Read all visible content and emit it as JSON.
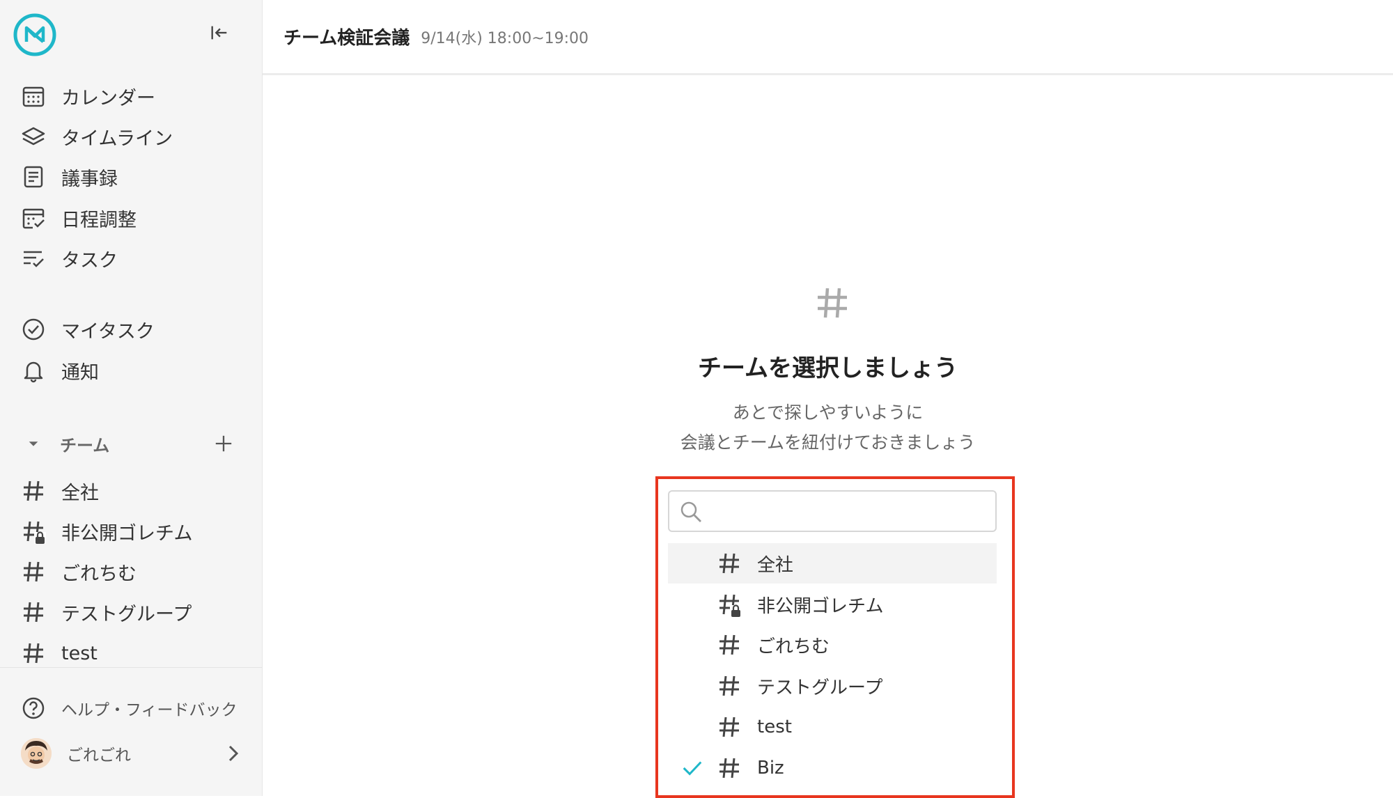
{
  "header": {
    "title": "チーム検証会議",
    "time": "9/14(水) 18:00~19:00"
  },
  "sidebar": {
    "nav": [
      {
        "label": "カレンダー",
        "icon": "calendar-icon"
      },
      {
        "label": "タイムライン",
        "icon": "layers-icon"
      },
      {
        "label": "議事録",
        "icon": "document-icon"
      },
      {
        "label": "日程調整",
        "icon": "schedule-check-icon"
      },
      {
        "label": "タスク",
        "icon": "task-list-icon"
      }
    ],
    "nav2": [
      {
        "label": "マイタスク",
        "icon": "check-circle-icon"
      },
      {
        "label": "通知",
        "icon": "bell-icon"
      }
    ],
    "team_section": "チーム",
    "teams": [
      {
        "label": "全社",
        "private": false
      },
      {
        "label": "非公開ゴレチム",
        "private": true
      },
      {
        "label": "ごれちむ",
        "private": false
      },
      {
        "label": "テストグループ",
        "private": false
      },
      {
        "label": "test",
        "private": false
      }
    ],
    "help": "ヘルプ・フィードバック",
    "user": "ごれごれ"
  },
  "main": {
    "heading": "チームを選択しましょう",
    "sub1": "あとで探しやすいように",
    "sub2": "会議とチームを紐付けておきましょう",
    "search_placeholder": "",
    "options": [
      {
        "label": "全社",
        "private": false,
        "selected": false
      },
      {
        "label": "非公開ゴレチム",
        "private": true,
        "selected": false
      },
      {
        "label": "ごれちむ",
        "private": false,
        "selected": false
      },
      {
        "label": "テストグループ",
        "private": false,
        "selected": false
      },
      {
        "label": "test",
        "private": false,
        "selected": false
      },
      {
        "label": "Biz",
        "private": false,
        "selected": true
      }
    ]
  },
  "colors": {
    "accent": "#1fb7c9",
    "highlight": "#e8361f"
  }
}
